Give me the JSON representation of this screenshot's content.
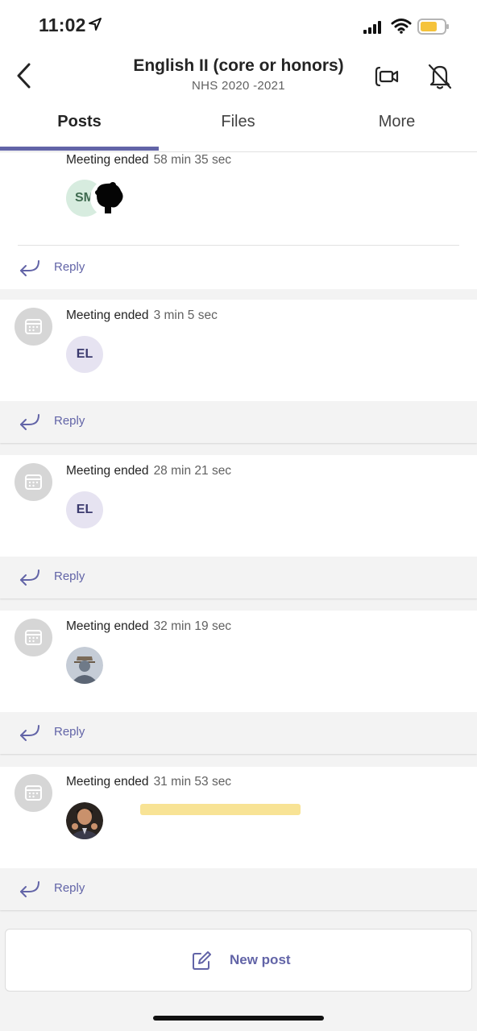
{
  "status_bar": {
    "time": "11:02"
  },
  "header": {
    "title": "English II (core or honors)",
    "subtitle": "NHS 2020 -2021"
  },
  "tabs": [
    {
      "label": "Posts",
      "active": true
    },
    {
      "label": "Files",
      "active": false
    },
    {
      "label": "More",
      "active": false
    }
  ],
  "posts": [
    {
      "text": "Meeting ended",
      "duration": "58 min 35 sec",
      "participants": [
        "SM",
        "photo-silhouette"
      ],
      "reply_label": "Reply"
    },
    {
      "text": "Meeting ended",
      "duration": "3 min 5 sec",
      "participants": [
        "EL"
      ],
      "reply_label": "Reply"
    },
    {
      "text": "Meeting ended",
      "duration": "28 min 21 sec",
      "participants": [
        "EL"
      ],
      "reply_label": "Reply"
    },
    {
      "text": "Meeting ended",
      "duration": "32 min 19 sec",
      "participants": [
        "default-avatar"
      ],
      "reply_label": "Reply"
    },
    {
      "text": "Meeting ended",
      "duration": "31 min 53 sec",
      "participants": [
        "photo-avatar"
      ],
      "reply_label": "Reply"
    }
  ],
  "new_post": {
    "label": "New post"
  },
  "colors": {
    "accent": "#6264a7",
    "background": "#f3f3f3"
  }
}
